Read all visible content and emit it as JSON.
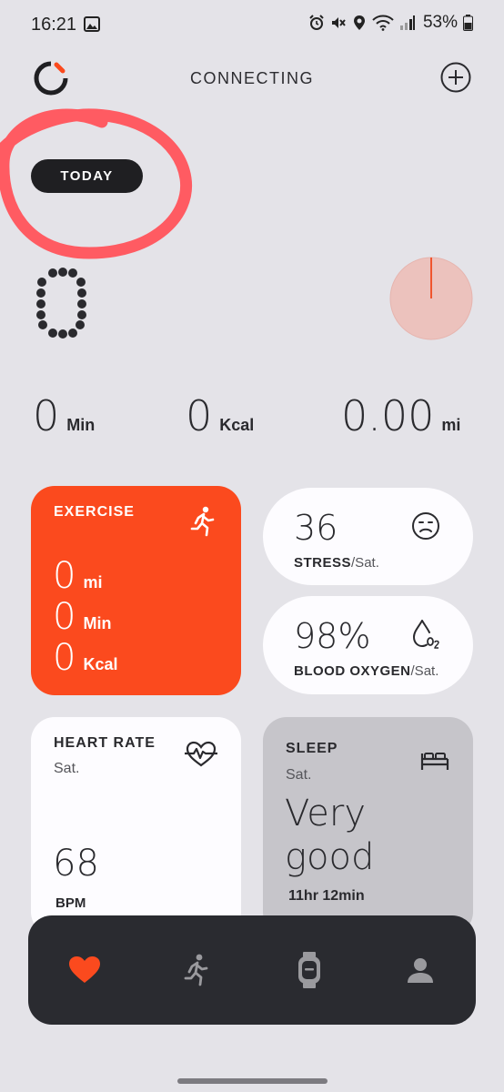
{
  "status_bar": {
    "time": "16:21",
    "battery": "53%"
  },
  "header": {
    "title": "CONNECTING"
  },
  "today_button": "TODAY",
  "steps": "0",
  "stats": [
    {
      "value": "0",
      "unit": "Min"
    },
    {
      "value": "0",
      "unit": "Kcal"
    },
    {
      "value": "0.00",
      "unit": "mi"
    }
  ],
  "exercise": {
    "title": "EXERCISE",
    "lines": [
      {
        "value": "0",
        "unit": "mi"
      },
      {
        "value": "0",
        "unit": "Min"
      },
      {
        "value": "0",
        "unit": "Kcal"
      }
    ]
  },
  "stress": {
    "value": "36",
    "label": "STRESS",
    "suffix": "/Sat."
  },
  "blood_oxygen": {
    "value": "98%",
    "label": "BLOOD OXYGEN",
    "suffix": "/Sat."
  },
  "heart_rate": {
    "title": "HEART RATE",
    "day": "Sat.",
    "value": "68",
    "unit": "BPM"
  },
  "sleep": {
    "title": "SLEEP",
    "day": "Sat.",
    "quality": "Very good",
    "duration": "11hr 12min"
  },
  "colors": {
    "accent": "#fb4a1e",
    "background": "#e4e3e8",
    "nav": "#2a2b30",
    "heart_active": "#fb4a1e"
  },
  "icons": {
    "nav": [
      "heart-icon",
      "running-icon",
      "watch-icon",
      "profile-icon"
    ]
  }
}
